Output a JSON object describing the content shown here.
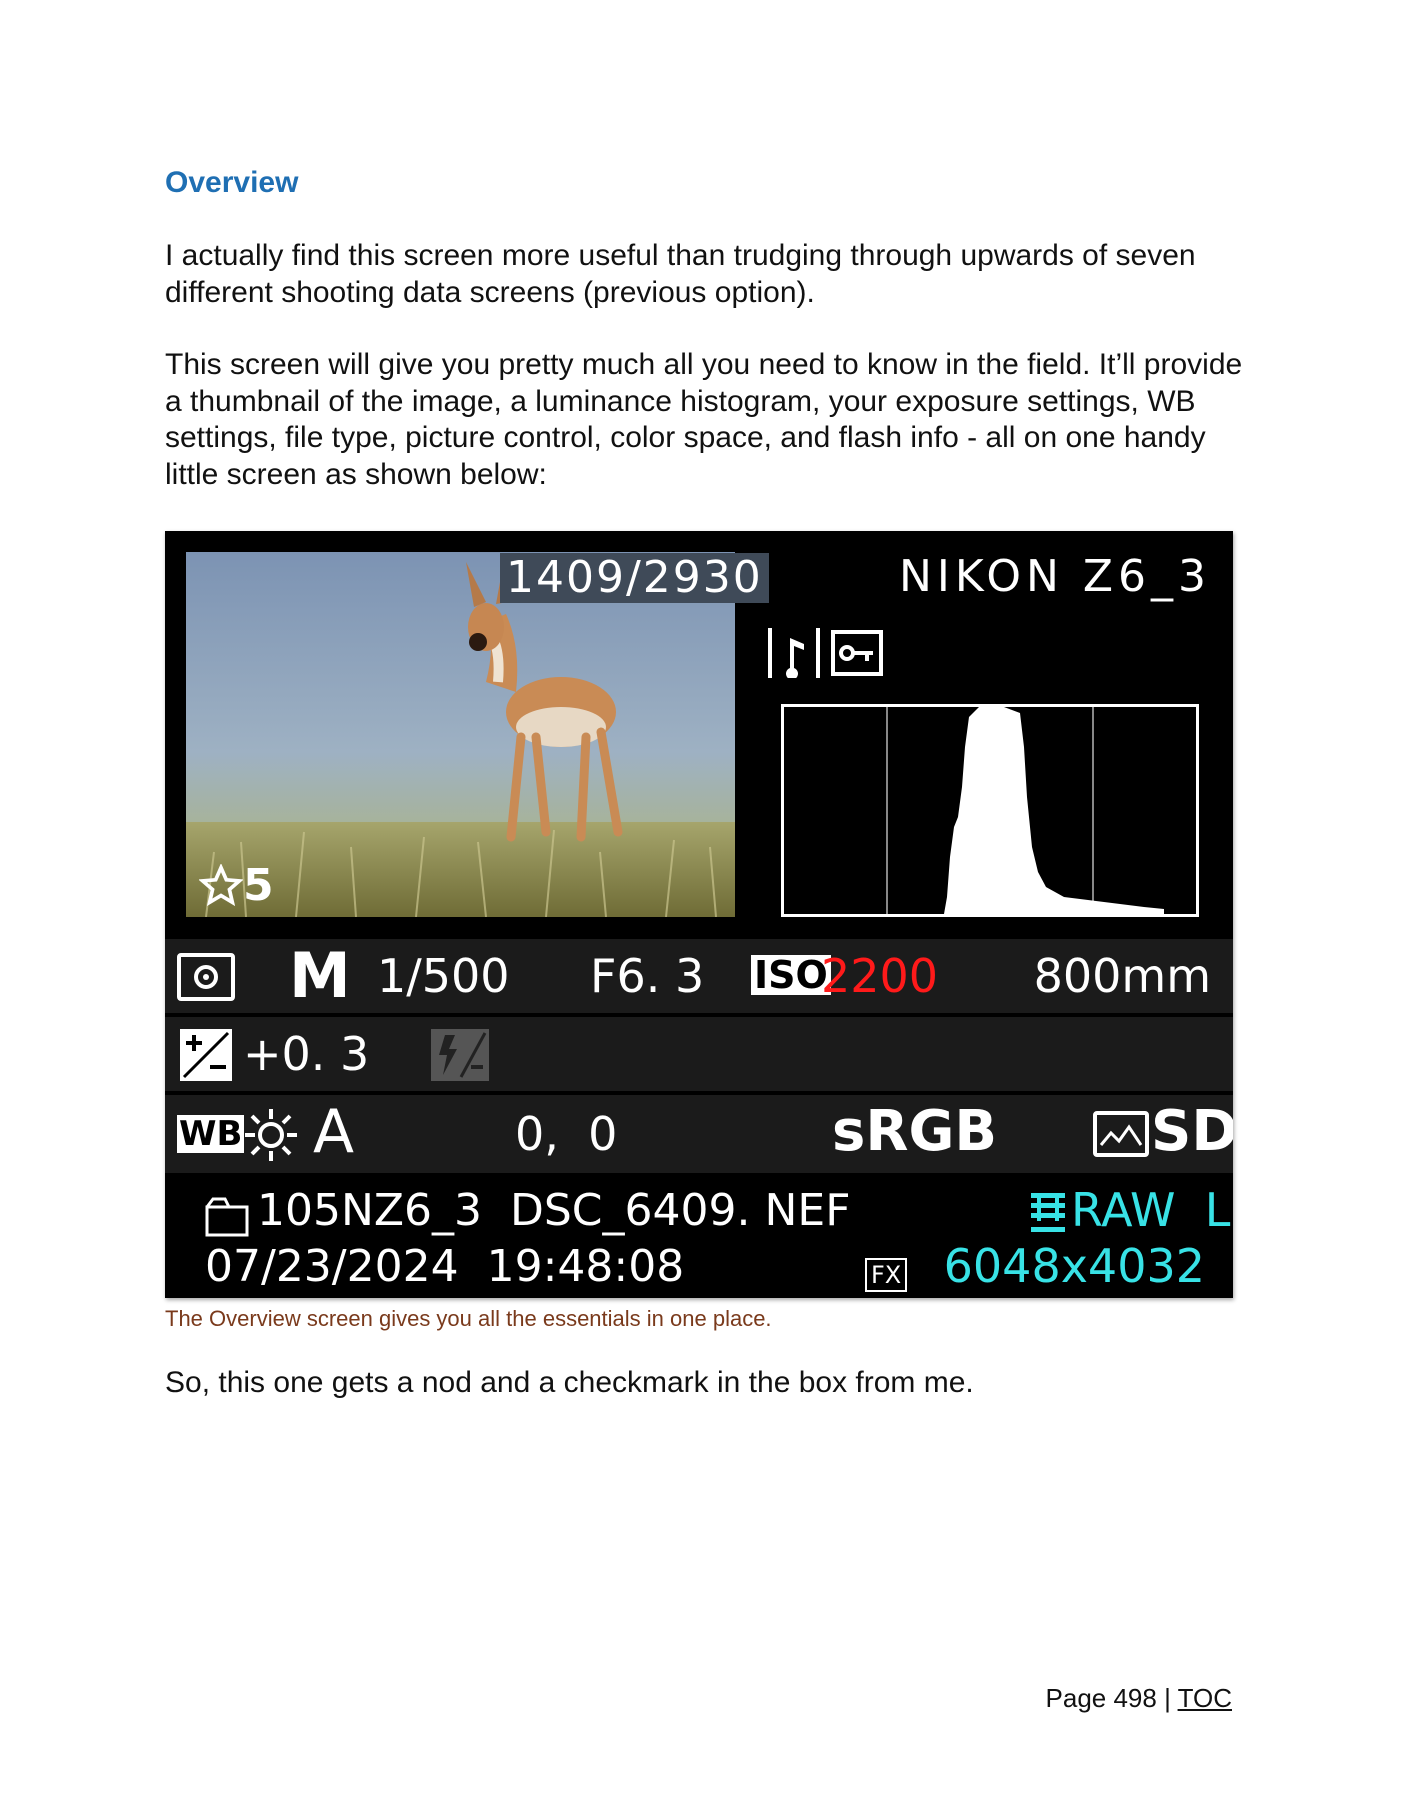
{
  "heading": "Overview",
  "paragraphs": [
    "I actually find this screen more useful than trudging through upwards of seven different shooting data screens (previous option).",
    "This screen will give you pretty much all you need to know in the field. It’ll provide a thumbnail of the image, a luminance histogram, your exposure settings, WB settings, file type, picture control, color space, and flash info - all on one handy little screen as shown below:",
    "So, this one gets a nod and a checkmark in the box from me."
  ],
  "camera_screen": {
    "frame_counter": "1409/2930",
    "camera_name": "NIKON Z6_3",
    "rating": "5",
    "mode": "M",
    "shutter": "1/500",
    "aperture": "F6. 3",
    "iso_label": "ISO",
    "iso_value": "2200",
    "focal_length": "800mm",
    "exposure_comp": "+0. 3",
    "wb_label": "WB",
    "wb_mode": "A",
    "wb_fine_tune": "0,  0",
    "color_space": "sRGB",
    "picture_control": "SD",
    "folder_file": "105NZ6_3  DSC_6409. NEF",
    "date_time": "07/23/2024  19:48:08",
    "image_area": "FX",
    "file_type": "RAW  L",
    "image_size": "6048x4032",
    "colors": {
      "background": "#000000",
      "row": "#1b1b1b",
      "iso_value": "#ff1a1a",
      "file_info": "#38e2e6",
      "frame_counter_bg": "#3f4a58"
    },
    "icons": [
      "metering-icon",
      "protect-icon",
      "voice-memo-icon",
      "exposure-comp-icon",
      "flash-comp-icon",
      "sun-icon",
      "picture-control-icon",
      "folder-icon",
      "image-quality-icon",
      "star-icon"
    ]
  },
  "caption": "The Overview screen gives you all the essentials in one place.",
  "footer": {
    "page_label": "Page 498 | ",
    "toc_link": "TOC"
  }
}
